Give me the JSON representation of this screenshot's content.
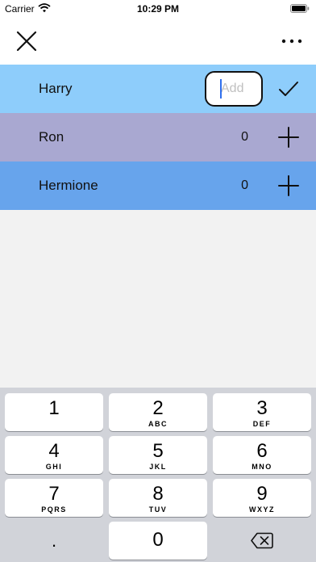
{
  "status_bar": {
    "carrier": "Carrier",
    "time": "10:29 PM",
    "wifi_icon": "wifi-icon",
    "battery_icon": "battery-icon"
  },
  "nav": {
    "close_icon": "close-icon",
    "more_icon": "more-icon"
  },
  "players": [
    {
      "name": "Harry",
      "color": "#8ecdfb",
      "input_placeholder": "Add",
      "action_icon": "checkmark-icon"
    },
    {
      "name": "Ron",
      "score": "0",
      "color": "#a9a8d1",
      "action_icon": "plus-icon"
    },
    {
      "name": "Hermione",
      "score": "0",
      "color": "#67a4ec",
      "action_icon": "plus-icon"
    }
  ],
  "keyboard": {
    "keys": [
      {
        "digit": "1",
        "letters": ""
      },
      {
        "digit": "2",
        "letters": "ABC"
      },
      {
        "digit": "3",
        "letters": "DEF"
      },
      {
        "digit": "4",
        "letters": "GHI"
      },
      {
        "digit": "5",
        "letters": "JKL"
      },
      {
        "digit": "6",
        "letters": "MNO"
      },
      {
        "digit": "7",
        "letters": "PQRS"
      },
      {
        "digit": "8",
        "letters": "TUV"
      },
      {
        "digit": "9",
        "letters": "WXYZ"
      }
    ],
    "dot": ".",
    "zero": "0",
    "delete_icon": "delete-icon"
  }
}
